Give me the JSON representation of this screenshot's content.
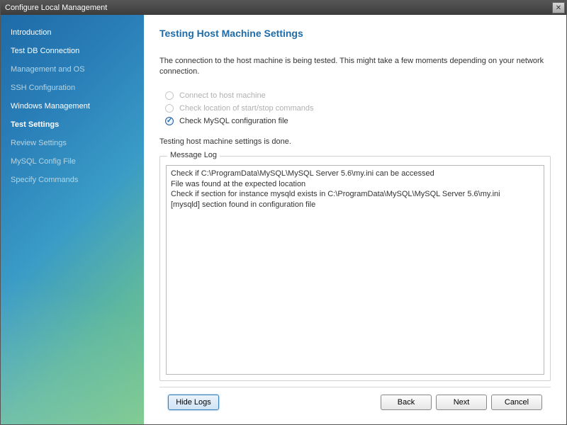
{
  "window": {
    "title": "Configure Local Management"
  },
  "sidebar": {
    "items": [
      {
        "label": "Introduction",
        "state": "done"
      },
      {
        "label": "Test DB Connection",
        "state": "done"
      },
      {
        "label": "Management and OS",
        "state": "pending"
      },
      {
        "label": "SSH Configuration",
        "state": "pending"
      },
      {
        "label": "Windows Management",
        "state": "done"
      },
      {
        "label": "Test Settings",
        "state": "active"
      },
      {
        "label": "Review Settings",
        "state": "pending"
      },
      {
        "label": "MySQL Config File",
        "state": "pending"
      },
      {
        "label": "Specify Commands",
        "state": "pending"
      }
    ]
  },
  "main": {
    "title": "Testing Host Machine Settings",
    "description": "The connection to the host machine is being tested. This might take a few moments depending on your network connection.",
    "checks": [
      {
        "label": "Connect to host machine",
        "status": "disabled"
      },
      {
        "label": "Check location of start/stop commands",
        "status": "disabled"
      },
      {
        "label": "Check MySQL configuration file",
        "status": "ok"
      }
    ],
    "status_line": "Testing host machine settings is done.",
    "log": {
      "legend": "Message Log",
      "lines": [
        "Check if C:\\ProgramData\\MySQL\\MySQL Server 5.6\\my.ini can be accessed",
        "File was found at the expected location",
        "Check if section for instance mysqld exists in C:\\ProgramData\\MySQL\\MySQL Server 5.6\\my.ini",
        "[mysqld] section found in configuration file"
      ]
    }
  },
  "footer": {
    "hide_logs": "Hide Logs",
    "back": "Back",
    "next": "Next",
    "cancel": "Cancel"
  }
}
